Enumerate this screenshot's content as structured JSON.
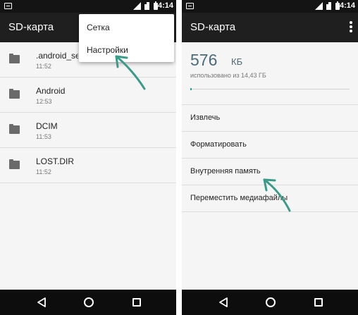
{
  "status": {
    "time": "14:14"
  },
  "left": {
    "title": "SD-карта",
    "files": [
      {
        "name": ".android_sec",
        "time": "11:52"
      },
      {
        "name": "Android",
        "time": "12:53"
      },
      {
        "name": "DCIM",
        "time": "11:53"
      },
      {
        "name": "LOST.DIR",
        "time": "11:52"
      }
    ],
    "menu": [
      {
        "label": "Сетка"
      },
      {
        "label": "Настройки"
      }
    ]
  },
  "right": {
    "title": "SD-карта",
    "storage": {
      "value": "576",
      "unit": "КБ",
      "subtitle": "использовано из 14,43 ГБ",
      "used_fraction": 4e-05
    },
    "actions": [
      {
        "label": "Извлечь"
      },
      {
        "label": "Форматировать"
      },
      {
        "label": "Внутренняя память"
      },
      {
        "label": "Переместить медиафайлы"
      }
    ]
  },
  "colors": {
    "accent": "#26a69a",
    "storage_text": "#4a6b7a",
    "arrow": "#3a9b8a"
  },
  "icons": {
    "folder": "folder-icon",
    "back": "back-icon",
    "home": "home-icon",
    "recents": "recents-icon",
    "overflow": "overflow-menu-icon"
  }
}
